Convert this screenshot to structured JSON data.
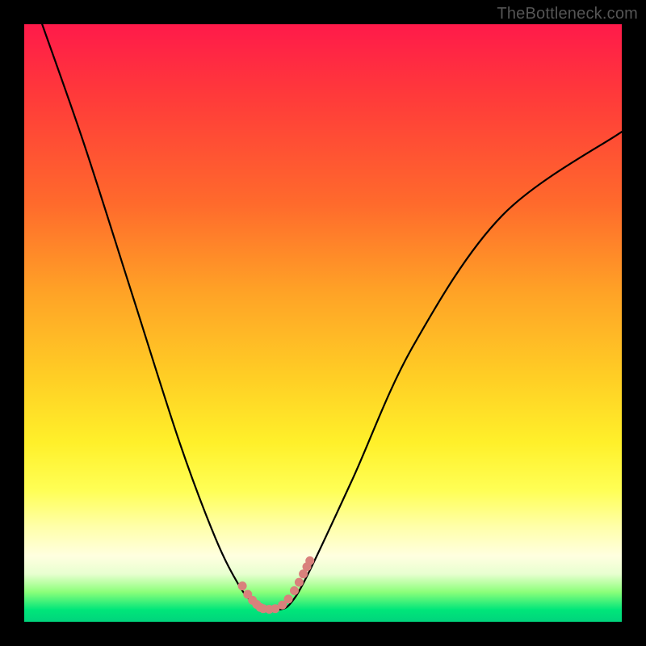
{
  "watermark": "TheBottleneck.com",
  "chart_data": {
    "type": "line",
    "title": "",
    "xlabel": "",
    "ylabel": "",
    "xlim": [
      0,
      100
    ],
    "ylim": [
      0,
      100
    ],
    "series": [
      {
        "name": "curve",
        "x": [
          3,
          10,
          18,
          26,
          32,
          36,
          38.5,
          40.5,
          42.5,
          44.5,
          47.5,
          55,
          65,
          80,
          100
        ],
        "y": [
          100,
          80,
          55,
          30,
          14,
          6,
          3,
          2,
          2,
          3,
          8,
          24,
          46,
          68,
          82
        ]
      }
    ],
    "valley_markers": {
      "name": "dotted-valley",
      "color": "#d9817c",
      "radius_css_px": 5.5,
      "points_x": [
        36.5,
        37.4,
        38.2,
        38.9,
        39.5,
        40.0,
        41.0,
        42.0,
        43.2,
        44.2,
        45.2,
        46.0,
        46.7,
        47.3,
        47.8
      ],
      "points_y": [
        6.0,
        4.6,
        3.6,
        2.9,
        2.4,
        2.2,
        2.1,
        2.2,
        2.8,
        3.8,
        5.2,
        6.6,
        8.0,
        9.2,
        10.2
      ]
    },
    "background_gradient_stops": [
      {
        "pos": 0.0,
        "color": "#ff1a4a"
      },
      {
        "pos": 0.45,
        "color": "#ffa326"
      },
      {
        "pos": 0.78,
        "color": "#ffff55"
      },
      {
        "pos": 0.95,
        "color": "#8cff7a"
      },
      {
        "pos": 1.0,
        "color": "#00d47c"
      }
    ]
  },
  "plot_geometry": {
    "inner_left": 30,
    "inner_top": 30,
    "inner_w": 740,
    "inner_h": 740
  }
}
